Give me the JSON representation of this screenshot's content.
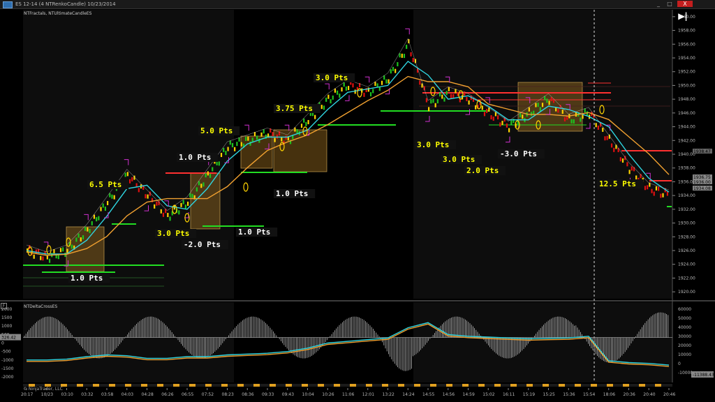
{
  "window": {
    "title": "ES 12-14 (4 NTRenkoCandle)  10/23/2014",
    "minimize": "_",
    "maximize": "□",
    "close": "X"
  },
  "price_panel": {
    "indicator_label": "NTFractals, NTUltimateCandleES",
    "price_labels": [
      "1936.75",
      "1936.00",
      "1934.08",
      "1938.47"
    ],
    "trade_labels": [
      {
        "text": "1.0 Pts",
        "color": "#ffffff"
      },
      {
        "text": "6.5 Pts",
        "color": "#ffff00"
      },
      {
        "text": "3.0 Pts",
        "color": "#ffff00"
      },
      {
        "text": "-2.0 Pts",
        "color": "#ffffff"
      },
      {
        "text": "1.0 Pts",
        "color": "#ffffff"
      },
      {
        "text": "1.0 Pts",
        "color": "#ffffff"
      },
      {
        "text": "5.0 Pts",
        "color": "#ffff00"
      },
      {
        "text": "1.0 Pts",
        "color": "#ffffff"
      },
      {
        "text": "3.75 Pts",
        "color": "#ffff00"
      },
      {
        "text": "3.0 Pts",
        "color": "#ffff00"
      },
      {
        "text": "3.0 Pts",
        "color": "#ffff00"
      },
      {
        "text": "3.0 Pts",
        "color": "#ffff00"
      },
      {
        "text": "2.0 Pts",
        "color": "#ffff00"
      },
      {
        "text": "-3.0 Pts",
        "color": "#ffffff"
      },
      {
        "text": "12.5 Pts",
        "color": "#ffff00"
      }
    ]
  },
  "oscillator_panel": {
    "indicator_label": "NTDeltaCrossES",
    "left_value_label": "326.42",
    "right_value_label": "-11388.43"
  },
  "footer": {
    "copyright": "© NinjaTrader, LLC"
  },
  "chart_data": [
    {
      "type": "line",
      "name_on_chart": "NTFractals, NTUltimateCandleES",
      "x": [
        "20:17",
        "10/23",
        "03:10",
        "03:32",
        "03:58",
        "04:03",
        "04:28",
        "06:26",
        "06:55",
        "07:52",
        "08:23",
        "08:36",
        "09:33",
        "09:43",
        "10:04",
        "10:26",
        "11:06",
        "12:01",
        "13:22",
        "14:24",
        "14:55",
        "14:56",
        "14:59",
        "15:02",
        "16:11",
        "15:19",
        "15:25",
        "15:36",
        "15:54",
        "18:06",
        "20:36",
        "20:40",
        "20:46"
      ],
      "y_axis_ticks": [
        1920,
        1922,
        1924,
        1926,
        1928,
        1930,
        1932,
        1934,
        1936,
        1938,
        1940,
        1942,
        1944,
        1946,
        1948,
        1950,
        1952,
        1954,
        1956,
        1958,
        1960
      ],
      "ylim": [
        1919,
        1961
      ],
      "series": [
        {
          "values": [
            1926,
            1925,
            1926,
            1929,
            1933,
            1937,
            1934,
            1931,
            1933,
            1937,
            1941,
            1942,
            1943,
            1942,
            1945,
            1948,
            1950,
            1949,
            1951,
            1956,
            1947,
            1949,
            1948,
            1946,
            1944,
            1946,
            1948,
            1945,
            1946,
            1942,
            1938,
            1935,
            1934
          ]
        }
      ]
    },
    {
      "type": "line",
      "name_on_chart": "NTDeltaCrossES",
      "y_axis_ticks_left": [
        2000,
        1500,
        1000,
        500,
        0,
        -500,
        -1000,
        -1500,
        -2000
      ],
      "y_axis_ticks_right": [
        60000,
        50000,
        40000,
        30000,
        20000,
        10000,
        0,
        -10000
      ],
      "series": [
        {
          "values": [
            -1000,
            -1000,
            -950,
            -800,
            -700,
            -750,
            -900,
            -900,
            -800,
            -800,
            -700,
            -650,
            -600,
            -500,
            -300,
            0,
            100,
            200,
            300,
            900,
            1200,
            500,
            400,
            350,
            300,
            250,
            280,
            300,
            400,
            -1050,
            -1150,
            -1200,
            -1300
          ]
        }
      ]
    }
  ]
}
